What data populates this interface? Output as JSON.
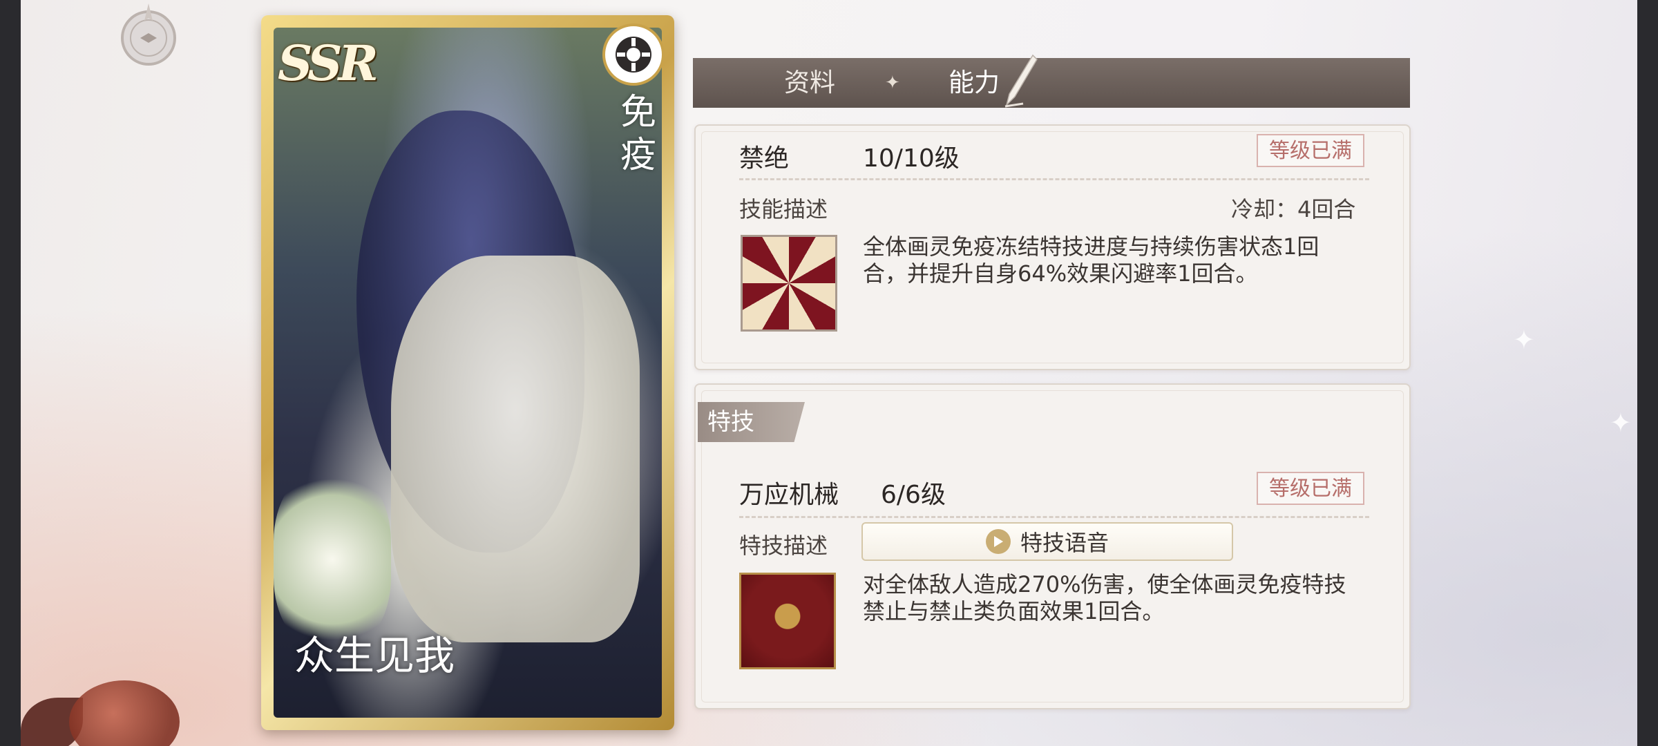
{
  "card": {
    "rarity": "SSR",
    "vertical_tag": "免疫",
    "title": "众生见我"
  },
  "tabs": [
    {
      "label": "资料"
    },
    {
      "label": "能力"
    }
  ],
  "skill": {
    "name": "禁绝",
    "level": "10/10级",
    "max_label": "等级已满",
    "desc_label": "技能描述",
    "cooldown": "冷却：4回合",
    "description": "全体画灵免疫冻结特技进度与持续伤害状态1回合，并提升自身64%效果闪避率1回合。"
  },
  "special": {
    "section_title": "特技",
    "name": "万应机械",
    "level": "6/6级",
    "max_label": "等级已满",
    "desc_label": "特技描述",
    "voice_button": "特技语音",
    "description": "对全体敌人造成270%伤害，使全体画灵免疫特技禁止与禁止类负面效果1回合。"
  }
}
